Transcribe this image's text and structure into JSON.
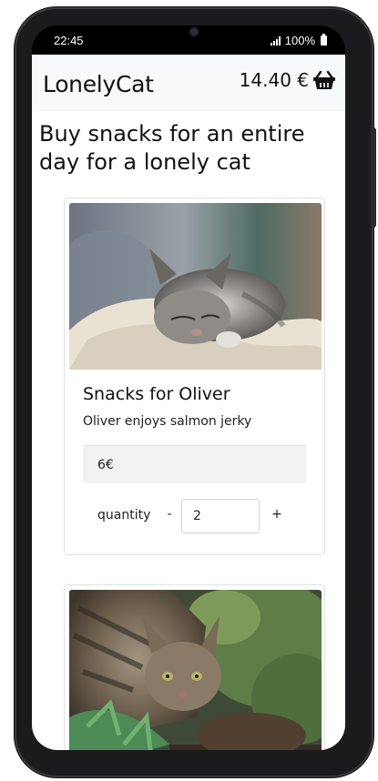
{
  "status": {
    "time": "22:45",
    "battery": "100%"
  },
  "navbar": {
    "brand": "LonelyCat",
    "cart_total": "14.40 €",
    "cart_icon": "basket-icon"
  },
  "page": {
    "heading": "Buy snacks for an entire day for a lonely cat"
  },
  "products": [
    {
      "title": "Snacks for Oliver",
      "description": "Oliver enjoys salmon jerky",
      "price": "6€",
      "quantity_label": "quantity",
      "minus_label": "-",
      "quantity": "2",
      "plus_label": "+"
    }
  ],
  "colors": {
    "navbar_bg": "#f8f9fa",
    "card_border": "#dee2e6",
    "price_bg": "#f2f2f2"
  }
}
